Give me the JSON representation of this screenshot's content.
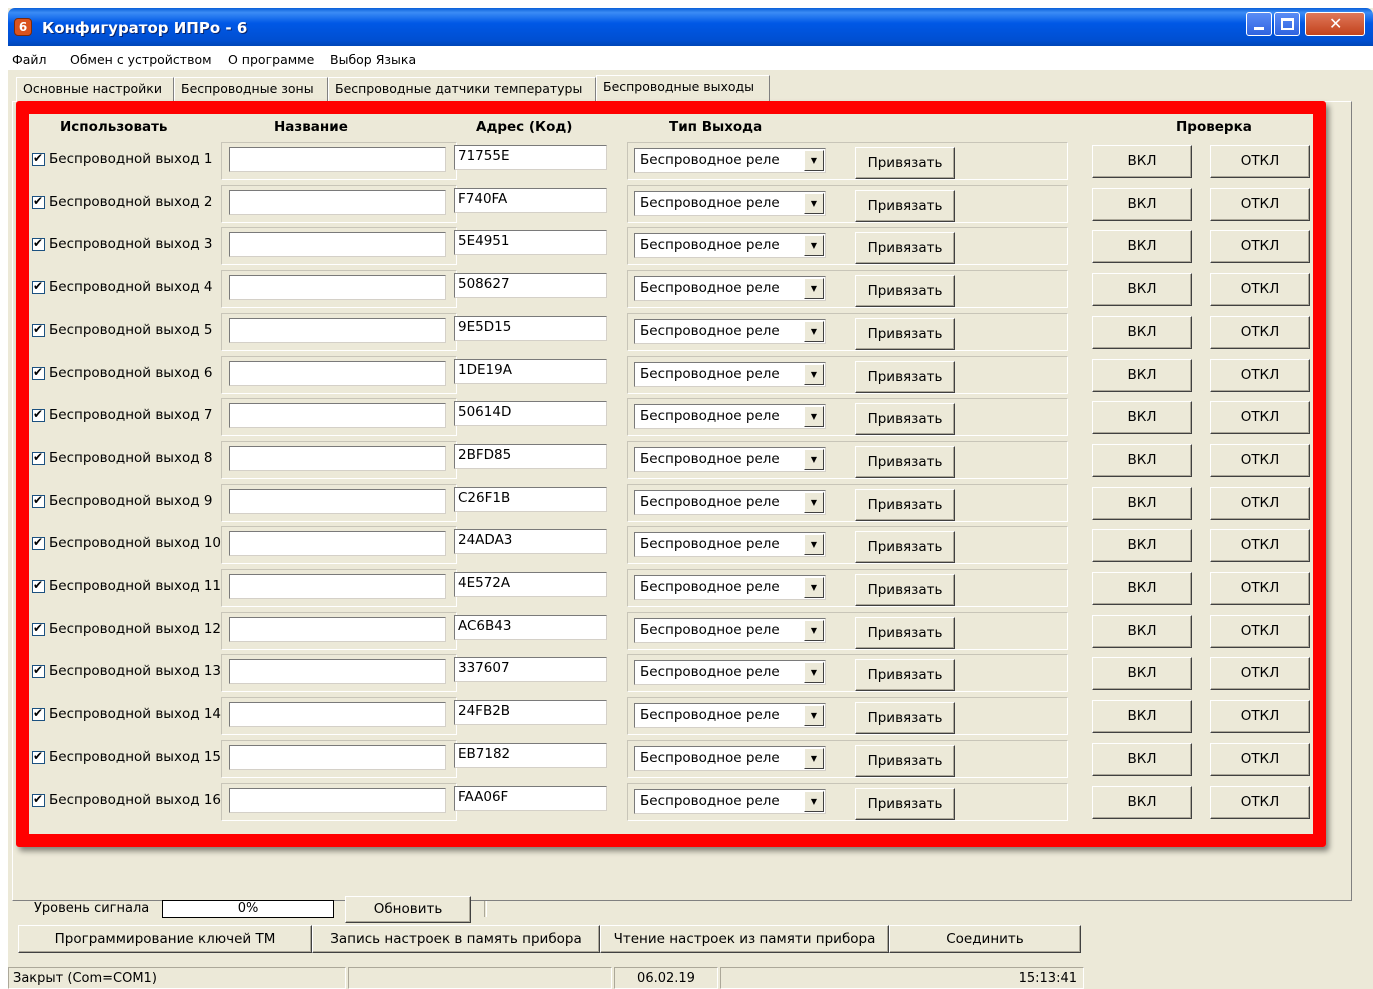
{
  "window": {
    "title": "Конфигуратор ИПРо - 6",
    "app_icon_glyph": "6",
    "close_glyph": "✕"
  },
  "menu": [
    "Файл",
    "Обмен с устройством",
    "О программе",
    "Выбор Языка"
  ],
  "tabs": [
    {
      "label": "Основные настройки",
      "active": false
    },
    {
      "label": "Беспроводные зоны",
      "active": false
    },
    {
      "label": "Беспроводные датчики температуры",
      "active": false
    },
    {
      "label": "Беспроводные выходы",
      "active": true
    }
  ],
  "headers": {
    "use": "Использовать",
    "name": "Название",
    "address": "Адрес (Код)",
    "type": "Тип Выхода",
    "check": "Проверка"
  },
  "outputs": [
    {
      "label": "Беспроводной выход 1",
      "checked": true,
      "name": "",
      "address": "71755E",
      "type": "Беспроводное реле"
    },
    {
      "label": "Беспроводной выход 2",
      "checked": true,
      "name": "",
      "address": "F740FA",
      "type": "Беспроводное реле"
    },
    {
      "label": "Беспроводной выход 3",
      "checked": true,
      "name": "",
      "address": "5E4951",
      "type": "Беспроводное реле"
    },
    {
      "label": "Беспроводной выход 4",
      "checked": true,
      "name": "",
      "address": "508627",
      "type": "Беспроводное реле"
    },
    {
      "label": "Беспроводной выход 5",
      "checked": true,
      "name": "",
      "address": "9E5D15",
      "type": "Беспроводное реле"
    },
    {
      "label": "Беспроводной выход 6",
      "checked": true,
      "name": "",
      "address": "1DE19A",
      "type": "Беспроводное реле"
    },
    {
      "label": "Беспроводной выход 7",
      "checked": true,
      "name": "",
      "address": "50614D",
      "type": "Беспроводное реле"
    },
    {
      "label": "Беспроводной выход 8",
      "checked": true,
      "name": "",
      "address": "2BFD85",
      "type": "Беспроводное реле"
    },
    {
      "label": "Беспроводной выход 9",
      "checked": true,
      "name": "",
      "address": "C26F1B",
      "type": "Беспроводное реле"
    },
    {
      "label": "Беспроводной выход 10",
      "checked": true,
      "name": "",
      "address": "24ADA3",
      "type": "Беспроводное реле"
    },
    {
      "label": "Беспроводной выход 11",
      "checked": true,
      "name": "",
      "address": "4E572A",
      "type": "Беспроводное реле"
    },
    {
      "label": "Беспроводной выход 12",
      "checked": true,
      "name": "",
      "address": "AC6B43",
      "type": "Беспроводное реле"
    },
    {
      "label": "Беспроводной выход 13",
      "checked": true,
      "name": "",
      "address": "337607",
      "type": "Беспроводное реле"
    },
    {
      "label": "Беспроводной выход 14",
      "checked": true,
      "name": "",
      "address": "24FB2B",
      "type": "Беспроводное реле"
    },
    {
      "label": "Беспроводной выход 15",
      "checked": true,
      "name": "",
      "address": "EB7182",
      "type": "Беспроводное реле"
    },
    {
      "label": "Беспроводной выход 16",
      "checked": true,
      "name": "",
      "address": "FAA06F",
      "type": "Беспроводное реле"
    }
  ],
  "row_buttons": {
    "bind": "Привязать",
    "on": "ВКЛ",
    "off": "ОТКЛ"
  },
  "bottom": {
    "signal_label": "Уровень сигнала",
    "signal_value": "0%",
    "refresh": "Обновить",
    "program_keys": "Программирование ключей ТМ",
    "write_settings": "Запись настроек в память прибора",
    "read_settings": "Чтение настроек из памяти прибора",
    "connect": "Соединить"
  },
  "status": {
    "connection": "Закрыт (Com=COM1)",
    "empty": "",
    "date": "06.02.19",
    "time": "15:13:41"
  },
  "colors": {
    "highlight": "#ff0000",
    "titlebar": "#0058e6",
    "window_bg": "#ece9d8"
  },
  "icons": [
    "app-icon",
    "minimize-icon",
    "maximize-icon",
    "close-icon",
    "checkbox-check-icon",
    "dropdown-arrow-icon"
  ]
}
